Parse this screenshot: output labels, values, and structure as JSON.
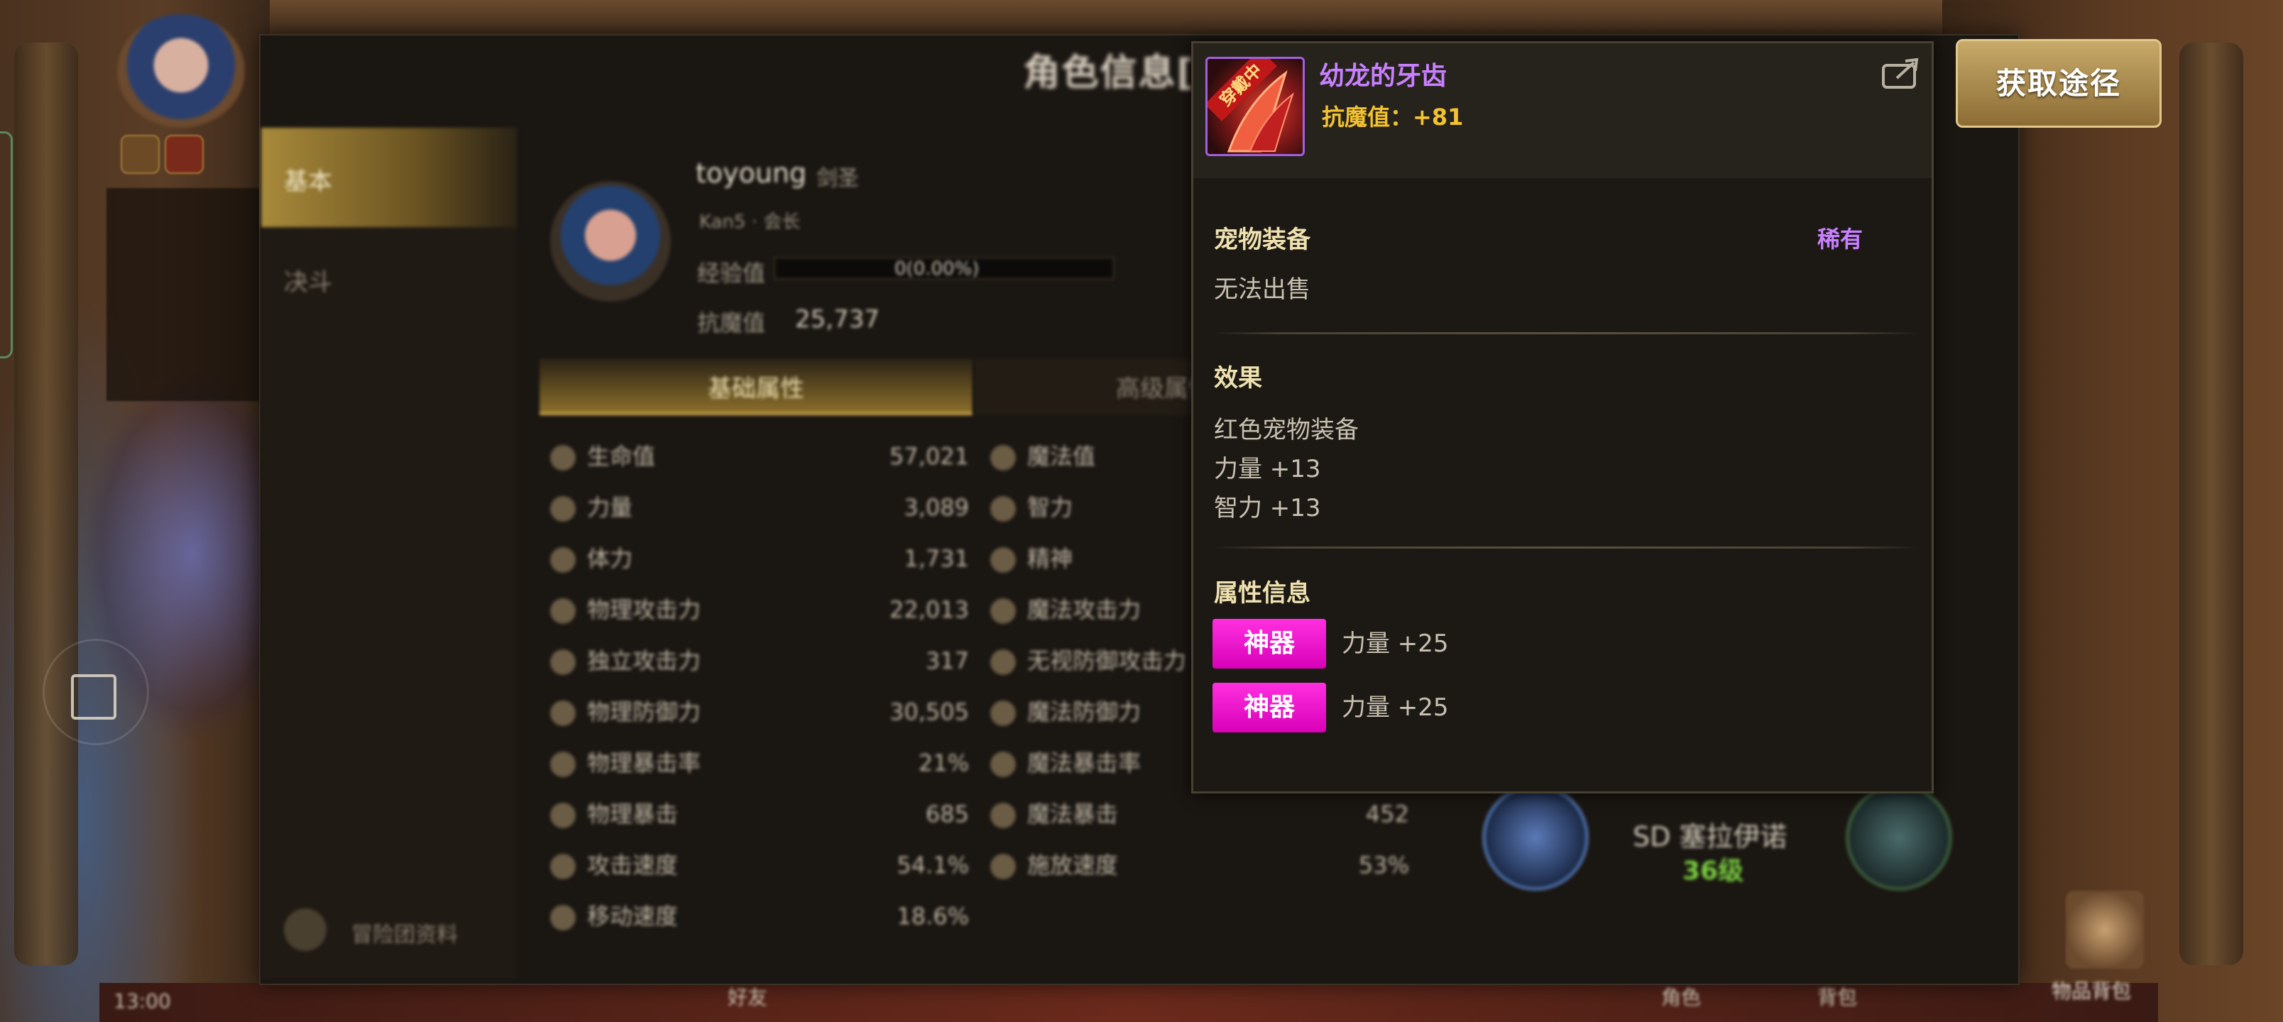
{
  "dialog": {
    "title": "角色信息[Ou",
    "sidebar": [
      "基本",
      "决斗"
    ],
    "sidebar_footer": "冒险团资料",
    "profile": {
      "name": "toyoung",
      "class": "剑圣",
      "exp_label": "经验值",
      "exp_value": "0(0.00%)",
      "resist_label": "抗魔值",
      "resist_value": "25,737",
      "sub_line": "Kan5 · 会长"
    },
    "tabs": [
      "基础属性",
      "高级属性"
    ],
    "stats_left": [
      {
        "label": "生命值",
        "value": "57,021"
      },
      {
        "label": "力量",
        "value": "3,089"
      },
      {
        "label": "体力",
        "value": "1,731"
      },
      {
        "label": "物理攻击力",
        "value": "22,013"
      },
      {
        "label": "独立攻击力",
        "value": "317"
      },
      {
        "label": "物理防御力",
        "value": "30,505"
      },
      {
        "label": "物理暴击率",
        "value": "21%"
      },
      {
        "label": "物理暴击",
        "value": "685"
      },
      {
        "label": "攻击速度",
        "value": "54.1%"
      },
      {
        "label": "移动速度",
        "value": "18.6%"
      }
    ],
    "stats_right": [
      {
        "label": "魔法值",
        "value": ""
      },
      {
        "label": "智力",
        "value": ""
      },
      {
        "label": "精神",
        "value": ""
      },
      {
        "label": "魔法攻击力",
        "value": ""
      },
      {
        "label": "无视防御攻击力",
        "value": ""
      },
      {
        "label": "魔法防御力",
        "value": ""
      },
      {
        "label": "魔法暴击率",
        "value": ""
      },
      {
        "label": "魔法暴击",
        "value": "452"
      },
      {
        "label": "施放速度",
        "value": "53%"
      }
    ],
    "pet": {
      "name": "SD 塞拉伊诺",
      "level": "36级"
    }
  },
  "acquire_button": "获取途径",
  "tooltip": {
    "item_name": "幼龙的牙齿",
    "equipped_ribbon": "穿戴中",
    "resist_line": "抗魔值：+81",
    "category": "宠物装备",
    "rarity": "稀有",
    "rarity_color": "#c880ff",
    "sell": "无法出售",
    "effect_title": "效果",
    "effects": [
      "红色宠物装备",
      "力量 +13",
      "智力 +13"
    ],
    "attr_title": "属性信息",
    "attrs": [
      {
        "tag": "神器",
        "text": "力量 +25"
      },
      {
        "tag": "神器",
        "text": "力量 +25"
      }
    ]
  },
  "status_bar": {
    "time": "13:00"
  },
  "bottom_menu": [
    "好友",
    "物品背包",
    "角色",
    "背包"
  ]
}
